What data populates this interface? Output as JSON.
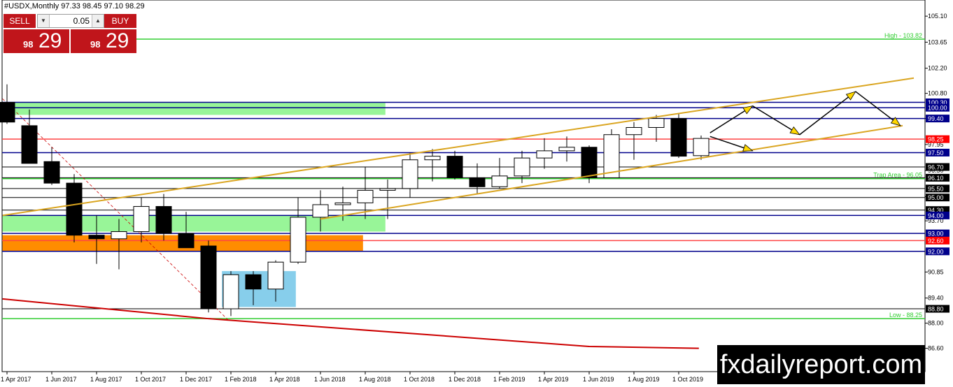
{
  "header": {
    "symbol_info": "#USDX,Monthly  97.33 98.45 97.10 98.29"
  },
  "trade_panel": {
    "sell_label": "SELL",
    "buy_label": "BUY",
    "lot_value": "0.05",
    "bid_small": "98",
    "bid_big": "29",
    "ask_small": "98",
    "ask_big": "29"
  },
  "watermark": "fxdailyreport.com",
  "colors": {
    "bull_candle": "#ffffff",
    "bear_candle": "#000000",
    "green_zone": "#98f598",
    "orange_zone": "#ff8c00",
    "blue_zone": "#87ceeb",
    "channel": "#daa520",
    "level_blue": "#00008b",
    "level_green": "#32cd32",
    "level_red": "#ff0000",
    "trend_red": "#cc0000",
    "arrow_head": "#ffd700"
  },
  "chart_data": {
    "type": "candlestick",
    "yticks": [
      "105.10",
      "103.65",
      "102.20",
      "100.80",
      "99.40",
      "97.95",
      "96.50",
      "95.05",
      "93.70",
      "90.85",
      "89.40",
      "88.00",
      "86.60"
    ],
    "yrange": [
      85.3,
      106.0
    ],
    "xlabels": [
      {
        "i": 0,
        "t": "1 Apr 2017"
      },
      {
        "i": 2,
        "t": "1 Jun 2017"
      },
      {
        "i": 4,
        "t": "1 Aug 2017"
      },
      {
        "i": 6,
        "t": "1 Oct 2017"
      },
      {
        "i": 8,
        "t": "1 Dec 2017"
      },
      {
        "i": 10,
        "t": "1 Feb 2018"
      },
      {
        "i": 12,
        "t": "1 Apr 2018"
      },
      {
        "i": 14,
        "t": "1 Jun 2018"
      },
      {
        "i": 16,
        "t": "1 Aug 2018"
      },
      {
        "i": 18,
        "t": "1 Oct 2018"
      },
      {
        "i": 20,
        "t": "1 Dec 2018"
      },
      {
        "i": 22,
        "t": "1 Feb 2019"
      },
      {
        "i": 24,
        "t": "1 Apr 2019"
      },
      {
        "i": 26,
        "t": "1 Jun 2019"
      },
      {
        "i": 28,
        "t": "1 Aug 2019"
      },
      {
        "i": 30,
        "t": "1 Oct 2019"
      }
    ],
    "candles": [
      {
        "o": 100.3,
        "h": 101.3,
        "l": 99.1,
        "c": 99.2
      },
      {
        "o": 99.0,
        "h": 99.9,
        "l": 96.9,
        "c": 96.9
      },
      {
        "o": 97.0,
        "h": 97.8,
        "l": 95.7,
        "c": 95.8
      },
      {
        "o": 95.8,
        "h": 96.3,
        "l": 92.5,
        "c": 92.9
      },
      {
        "o": 92.9,
        "h": 94.0,
        "l": 91.3,
        "c": 92.7
      },
      {
        "o": 92.7,
        "h": 93.8,
        "l": 91.0,
        "c": 93.1
      },
      {
        "o": 93.1,
        "h": 95.0,
        "l": 92.5,
        "c": 94.5
      },
      {
        "o": 94.5,
        "h": 95.2,
        "l": 92.6,
        "c": 93.0
      },
      {
        "o": 93.0,
        "h": 94.2,
        "l": 92.3,
        "c": 92.2
      },
      {
        "o": 92.3,
        "h": 92.6,
        "l": 88.6,
        "c": 88.8
      },
      {
        "o": 88.8,
        "h": 90.9,
        "l": 88.4,
        "c": 90.7
      },
      {
        "o": 90.7,
        "h": 90.9,
        "l": 89.0,
        "c": 89.9
      },
      {
        "o": 89.9,
        "h": 91.5,
        "l": 89.2,
        "c": 91.4
      },
      {
        "o": 91.4,
        "h": 95.0,
        "l": 91.3,
        "c": 93.9
      },
      {
        "o": 93.9,
        "h": 95.4,
        "l": 93.1,
        "c": 94.6
      },
      {
        "o": 94.6,
        "h": 95.6,
        "l": 93.7,
        "c": 94.7
      },
      {
        "o": 94.7,
        "h": 96.7,
        "l": 93.8,
        "c": 95.4
      },
      {
        "o": 95.4,
        "h": 96.0,
        "l": 93.8,
        "c": 95.5
      },
      {
        "o": 95.5,
        "h": 97.5,
        "l": 95.0,
        "c": 97.1
      },
      {
        "o": 97.1,
        "h": 97.7,
        "l": 95.9,
        "c": 97.3
      },
      {
        "o": 97.3,
        "h": 97.6,
        "l": 96.0,
        "c": 96.1
      },
      {
        "o": 96.1,
        "h": 96.9,
        "l": 95.2,
        "c": 95.6
      },
      {
        "o": 95.6,
        "h": 97.2,
        "l": 95.5,
        "c": 96.2
      },
      {
        "o": 96.2,
        "h": 97.6,
        "l": 95.8,
        "c": 97.2
      },
      {
        "o": 97.2,
        "h": 98.3,
        "l": 96.6,
        "c": 97.6
      },
      {
        "o": 97.6,
        "h": 98.4,
        "l": 97.0,
        "c": 97.8
      },
      {
        "o": 97.8,
        "h": 97.9,
        "l": 95.8,
        "c": 96.1
      },
      {
        "o": 96.1,
        "h": 98.8,
        "l": 96.1,
        "c": 98.5
      },
      {
        "o": 98.5,
        "h": 99.2,
        "l": 97.1,
        "c": 98.9
      },
      {
        "o": 98.9,
        "h": 99.6,
        "l": 98.1,
        "c": 99.4
      },
      {
        "o": 99.4,
        "h": 99.7,
        "l": 97.2,
        "c": 97.3
      },
      {
        "o": 97.33,
        "h": 98.45,
        "l": 97.1,
        "c": 98.29
      }
    ],
    "levels": [
      {
        "v": 103.82,
        "color": "#32cd32",
        "text": "High - 103.82",
        "x0": 195
      },
      {
        "v": 100.3,
        "color": "#00008b",
        "box": "100.30"
      },
      {
        "v": 100.0,
        "color": "#00008b",
        "box": "100.00"
      },
      {
        "v": 99.4,
        "color": "#00008b",
        "box": "99.40"
      },
      {
        "v": 98.25,
        "color": "#ff4444",
        "box": "98.25",
        "boxcolor": "#ff0000"
      },
      {
        "v": 97.5,
        "color": "#00008b",
        "box": "97.50"
      },
      {
        "v": 96.7,
        "color": "#000000",
        "box": "96.70"
      },
      {
        "v": 96.05,
        "color": "#32cd32",
        "text": "Trap Area - 96.05"
      },
      {
        "v": 96.1,
        "color": "#000000",
        "box": "96.10"
      },
      {
        "v": 95.5,
        "color": "#000000",
        "box": "95.50"
      },
      {
        "v": 95.0,
        "color": "#000000",
        "box": "95.00"
      },
      {
        "v": 94.3,
        "color": "#000000",
        "box": "94.30"
      },
      {
        "v": 94.0,
        "color": "#00008b",
        "box": "94.00"
      },
      {
        "v": 93.0,
        "color": "#00008b",
        "box": "93.00"
      },
      {
        "v": 92.6,
        "color": "#ff4444",
        "box": "92.60",
        "boxcolor": "#ff0000"
      },
      {
        "v": 92.0,
        "color": "#00008b",
        "box": "92.00"
      },
      {
        "v": 88.8,
        "color": "#000000",
        "box": "88.80"
      },
      {
        "v": 88.25,
        "color": "#32cd32",
        "text": "Low - 88.25"
      }
    ],
    "zones": [
      {
        "i0": -0.2,
        "i1": 16.9,
        "top": 100.3,
        "bot": 99.6,
        "color": "#98f598"
      },
      {
        "i0": -0.2,
        "i1": 16.9,
        "top": 94.0,
        "bot": 93.1,
        "color": "#98f598"
      },
      {
        "i0": -0.2,
        "i1": 15.9,
        "top": 92.9,
        "bot": 92.0,
        "color": "#ff8c00"
      },
      {
        "i0": 9.6,
        "i1": 12.9,
        "top": 90.9,
        "bot": 88.9,
        "color": "#87ceeb"
      }
    ],
    "channel_upper": [
      [
        -0.2,
        94.0
      ],
      [
        40.5,
        101.65
      ]
    ],
    "channel_lower": [
      [
        14.0,
        93.8
      ],
      [
        40.0,
        99.0
      ]
    ],
    "red_trend": [
      [
        -0.2,
        89.35
      ],
      [
        9.0,
        88.25
      ],
      [
        26.0,
        86.7
      ],
      [
        30.9,
        86.6
      ]
    ],
    "dashed_trend": [
      [
        -0.2,
        100.5
      ],
      [
        9.9,
        88.15
      ]
    ],
    "path_a": [
      [
        31.4,
        98.6
      ],
      [
        33.3,
        100.1
      ],
      [
        35.4,
        98.5
      ],
      [
        37.9,
        100.9
      ],
      [
        39.9,
        99.0
      ]
    ],
    "path_b": [
      [
        31.4,
        98.4
      ],
      [
        33.3,
        97.6
      ]
    ]
  }
}
